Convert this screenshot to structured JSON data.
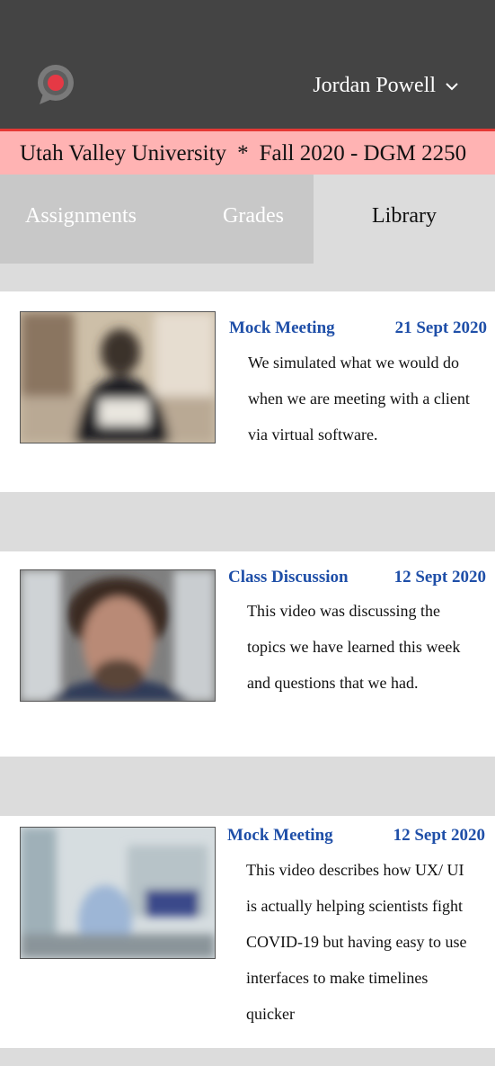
{
  "header": {
    "logo_icon": "speech-bubble-icon",
    "user_name": "Jordan Powell"
  },
  "course": {
    "school": "Utah Valley University",
    "separator": "*",
    "term": "Fall 2020 - DGM 2250"
  },
  "tabs": [
    {
      "label": "Assignments",
      "active": false
    },
    {
      "label": "Grades",
      "active": false
    },
    {
      "label": "Library",
      "active": true
    }
  ],
  "library": [
    {
      "title": "Mock Meeting",
      "date": "21 Sept 2020",
      "description": "We simulated what we would do when we are meeting with a client via virtual software."
    },
    {
      "title": "Class Discussion",
      "date": "12 Sept 2020",
      "description": "This video was discussing the topics we have learned this week and questions that we had."
    },
    {
      "title": "Mock Meeting",
      "date": "12 Sept 2020",
      "description": "This video describes how UX/ UI is actually helping scientists fight COVID-19 but having easy to use interfaces to make timelines quicker"
    }
  ],
  "colors": {
    "topbar": "#444444",
    "accent": "#e53935",
    "course_bar": "#ffb3b3",
    "link": "#1f4fa8"
  }
}
